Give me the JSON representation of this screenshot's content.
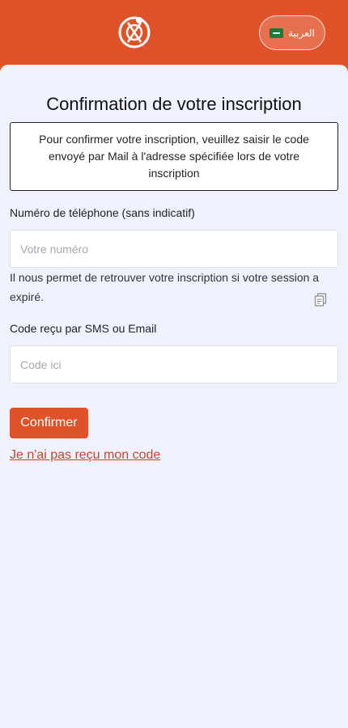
{
  "header": {
    "language_label": "العربية"
  },
  "form": {
    "title": "Confirmation de votre inscription",
    "info_text": "Pour confirmer votre inscription, veuillez saisir le code envoyé par Mail à l'adresse spécifiée lors de votre inscription",
    "phone_label": "Numéro de téléphone (sans indicatif)",
    "phone_placeholder": "Votre numéro",
    "phone_help": "Il nous permet de retrouver votre inscription si votre session a expiré.",
    "code_label": "Code reçu par SMS ou Email",
    "code_placeholder": "Code ici",
    "confirm_label": "Confirmer",
    "resend_label": "Je n'ai pas reçu mon code"
  },
  "colors": {
    "accent": "#e0522a",
    "background": "#eff2fc",
    "link": "#c9442a"
  },
  "icons": {
    "logo": "brand-logo",
    "flag": "saudi-flag-icon",
    "paste": "paste-icon"
  }
}
